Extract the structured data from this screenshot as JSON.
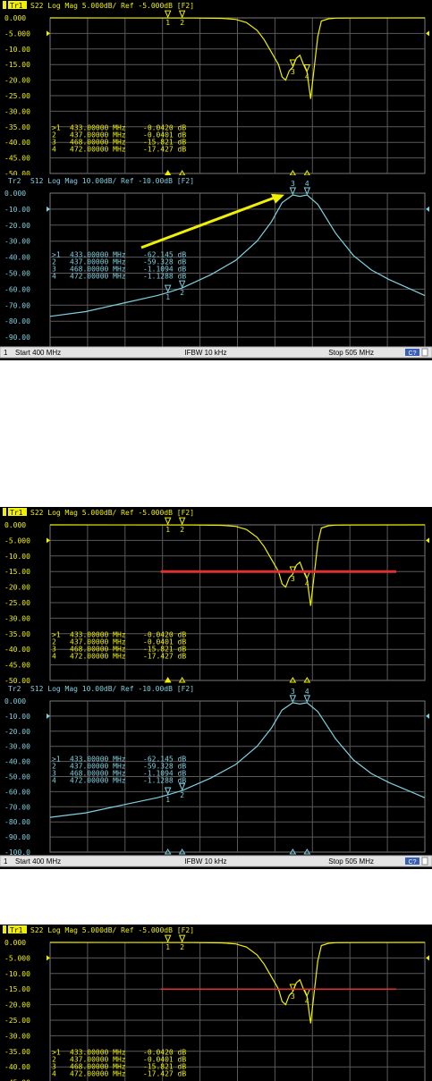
{
  "colors": {
    "s22": "#f0f000",
    "s12": "#7fd0e0",
    "grid": "#5a5a5a",
    "background": "#000000",
    "limit_line": "#e03030",
    "arrow": "#f0f000"
  },
  "trace1": {
    "badge": "Tr1",
    "header": "S22 Log Mag 5.000dB/ Ref -5.000dB [F2]",
    "y_tick_labels": [
      "0.000",
      "-5.000",
      "-10.00",
      "-15.00",
      "-20.00",
      "-25.00",
      "-30.00",
      "-35.00",
      "-40.00",
      "-45.00",
      "-50.00"
    ],
    "markers": [
      {
        "id": "1",
        "freq": "433.00000 MHz",
        "value": "-0.0420 dB"
      },
      {
        "id": "2",
        "freq": "437.00000 MHz",
        "value": "-0.0401 dB"
      },
      {
        "id": "3",
        "freq": "468.00000 MHz",
        "value": "-15.821 dB"
      },
      {
        "id": "4",
        "freq": "472.00000 MHz",
        "value": "-17.427 dB"
      }
    ]
  },
  "trace2": {
    "badge": "Tr2",
    "header": "S12 Log Mag 10.00dB/ Ref -10.00dB [F2]",
    "y_tick_labels": [
      "0.000",
      "-10.00",
      "-20.00",
      "-30.00",
      "-40.00",
      "-50.00",
      "-60.00",
      "-70.00",
      "-80.00",
      "-90.00",
      "-100.0"
    ],
    "markers": [
      {
        "id": "1",
        "freq": "433.00000 MHz",
        "value": "-62.145 dB"
      },
      {
        "id": "2",
        "freq": "437.00000 MHz",
        "value": "-59.328 dB"
      },
      {
        "id": "3",
        "freq": "468.00000 MHz",
        "value": "-1.1094 dB"
      },
      {
        "id": "4",
        "freq": "472.00000 MHz",
        "value": "-1.1288 dB"
      }
    ]
  },
  "status_bar": {
    "channel": "1",
    "start": "Start 400 MHz",
    "ifbw": "IFBW 10 kHz",
    "stop": "Stop 505 MHz",
    "badge": "C?"
  },
  "chart_data": [
    {
      "type": "line",
      "title": "S22 Log Mag 5.000dB/ Ref -5.000dB [F2]",
      "x_unit": "MHz",
      "xlim": [
        400,
        505
      ],
      "ylim": [
        -50,
        0
      ],
      "grid": true,
      "series": [
        {
          "name": "S22",
          "x": [
            400,
            440,
            448,
            452,
            455,
            458,
            460,
            462,
            464,
            465,
            466,
            467,
            468,
            469,
            470,
            471,
            472,
            473,
            474,
            475,
            476,
            478,
            480,
            485,
            505
          ],
          "y": [
            -0.01,
            -0.04,
            -0.15,
            -0.5,
            -1.5,
            -4,
            -7,
            -11,
            -15,
            -19,
            -20,
            -17,
            -15.8,
            -13,
            -12,
            -15,
            -17.4,
            -26,
            -16,
            -6,
            -1,
            -0.3,
            -0.1,
            -0.02,
            -0.01
          ]
        }
      ]
    },
    {
      "type": "line",
      "title": "S12 Log Mag 10.00dB/ Ref -10.00dB [F2]",
      "x_unit": "MHz",
      "xlim": [
        400,
        505
      ],
      "ylim": [
        -100,
        0
      ],
      "grid": true,
      "series": [
        {
          "name": "S12",
          "x": [
            400,
            410,
            420,
            430,
            433,
            437,
            445,
            452,
            458,
            462,
            465,
            468,
            470,
            472,
            475,
            480,
            485,
            490,
            495,
            500,
            505
          ],
          "y": [
            -77,
            -74,
            -69,
            -64,
            -62.1,
            -59.3,
            -51,
            -42,
            -30,
            -18,
            -6,
            -1.1,
            -2,
            -1.1,
            -7,
            -25,
            -39,
            -48,
            -54,
            -59,
            -64
          ]
        }
      ]
    }
  ]
}
